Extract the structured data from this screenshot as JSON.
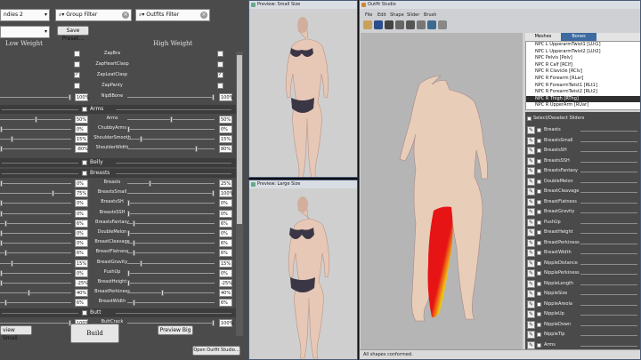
{
  "bodyslide": {
    "preset_label": "ndies 2",
    "group_filter_placeholder": "Group Filter",
    "outfits_filter_placeholder": "Outfits Filter",
    "save_preset": "Save Preset...",
    "low_weight": "Low Weight",
    "high_weight": "High Weight",
    "zap_sliders": [
      {
        "name": "ZapBra",
        "low_checked": false,
        "high_checked": false
      },
      {
        "name": "ZapHeartClasp",
        "low_checked": false,
        "high_checked": false
      },
      {
        "name": "ZapLeatClasp",
        "low_checked": true,
        "high_checked": true
      },
      {
        "name": "ZapPanty",
        "low_checked": false,
        "high_checked": false
      }
    ],
    "nip_slider": {
      "name": "NipBBone",
      "low": "100%",
      "high": "100%"
    },
    "categories": {
      "arms": "Arms",
      "belly": "Belly",
      "breasts": "Breasts",
      "butt": "Butt"
    },
    "arms_sliders": [
      {
        "name": "Arms",
        "low": "50%",
        "high": "50%"
      },
      {
        "name": "ChubbyArms",
        "low": "0%",
        "high": "0%"
      },
      {
        "name": "ShoulderSmooth",
        "low": "15%",
        "high": "15%"
      },
      {
        "name": "ShoulderWidth",
        "low": "-80%",
        "high": "80%"
      }
    ],
    "breast_sliders": [
      {
        "name": "Breasts",
        "low": "0%",
        "high": "25%"
      },
      {
        "name": "BreastsSmall",
        "low": "75%",
        "high": "100%"
      },
      {
        "name": "BreastsSH",
        "low": "0%",
        "high": "0%"
      },
      {
        "name": "BreastsSSH",
        "low": "0%",
        "high": "0%"
      },
      {
        "name": "BreastsFantasy",
        "low": "6%",
        "high": "6%"
      },
      {
        "name": "DoubleMelon",
        "low": "0%",
        "high": "0%"
      },
      {
        "name": "BreastCleavage",
        "low": "0%",
        "high": "6%"
      },
      {
        "name": "BreastFlatness",
        "low": "6%",
        "high": "6%"
      },
      {
        "name": "BreastGravity",
        "low": "15%",
        "high": "15%"
      },
      {
        "name": "PushUp",
        "low": "0%",
        "high": "0%"
      },
      {
        "name": "BreastHeight",
        "low": "-25%",
        "high": "-25%"
      },
      {
        "name": "BreastPerkiness",
        "low": "40%",
        "high": "40%"
      },
      {
        "name": "BreastWidth",
        "low": "6%",
        "high": "6%"
      }
    ],
    "butt_slider": {
      "name": "ButtCrack",
      "low": "100%",
      "high": "100%"
    },
    "preview_small": "view Small",
    "build": "Build",
    "preview_big": "Preview Big",
    "open_outfit_studio": "Open Outfit Studio..."
  },
  "preview_small": {
    "title": "Preview: Small Size"
  },
  "preview_large": {
    "title": "Preview: Large Size"
  },
  "outfit_studio": {
    "title": "Outfit Studio",
    "menu": [
      "File",
      "Edit",
      "Shape",
      "Slider",
      "Brush"
    ],
    "tabs": [
      "Meshes",
      "Bones"
    ],
    "active_tab": "Bones",
    "bones": [
      "NPC L UpperarmTwist1 [LUt1]",
      "NPC L UpperarmTwist2 [LUt2]",
      "NPC Pelvis [Pelv]",
      "NPC R Calf [RClf]",
      "NPC R Clavicle [RClv]",
      "NPC R Forearm [RLar]",
      "NPC R ForearmTwist1 [RLt1]",
      "NPC R ForearmTwist2 [RLt2]",
      "NPC R Thigh [RThg]",
      "NPC R UpperArm [RUar]",
      "NPC R UpperarmTwist1 [RUt1]"
    ],
    "selected_bone": "NPC R Thigh [RThg]",
    "select_all": "Select/Deselect Sliders",
    "sliders": [
      "Breasts",
      "BreastsSmall",
      "BreastsSH",
      "BreastsSSH",
      "BreastsFantasy",
      "DoubleMelon",
      "BreastCleavage",
      "BreastFlatness",
      "BreastGravity",
      "PushUp",
      "BreastHeight",
      "BreastPerkiness",
      "BreastWidth",
      "NippleDistance",
      "NipplePerkiness",
      "NippleLength",
      "NippleSize",
      "NippleAreola",
      "NippleUp",
      "NippleDown",
      "NippleTip",
      "Arms"
    ],
    "status": "All shapes conformed.",
    "colors": {
      "weight_hot": "#e61414",
      "weight_cold": "#1e3cc8"
    }
  }
}
